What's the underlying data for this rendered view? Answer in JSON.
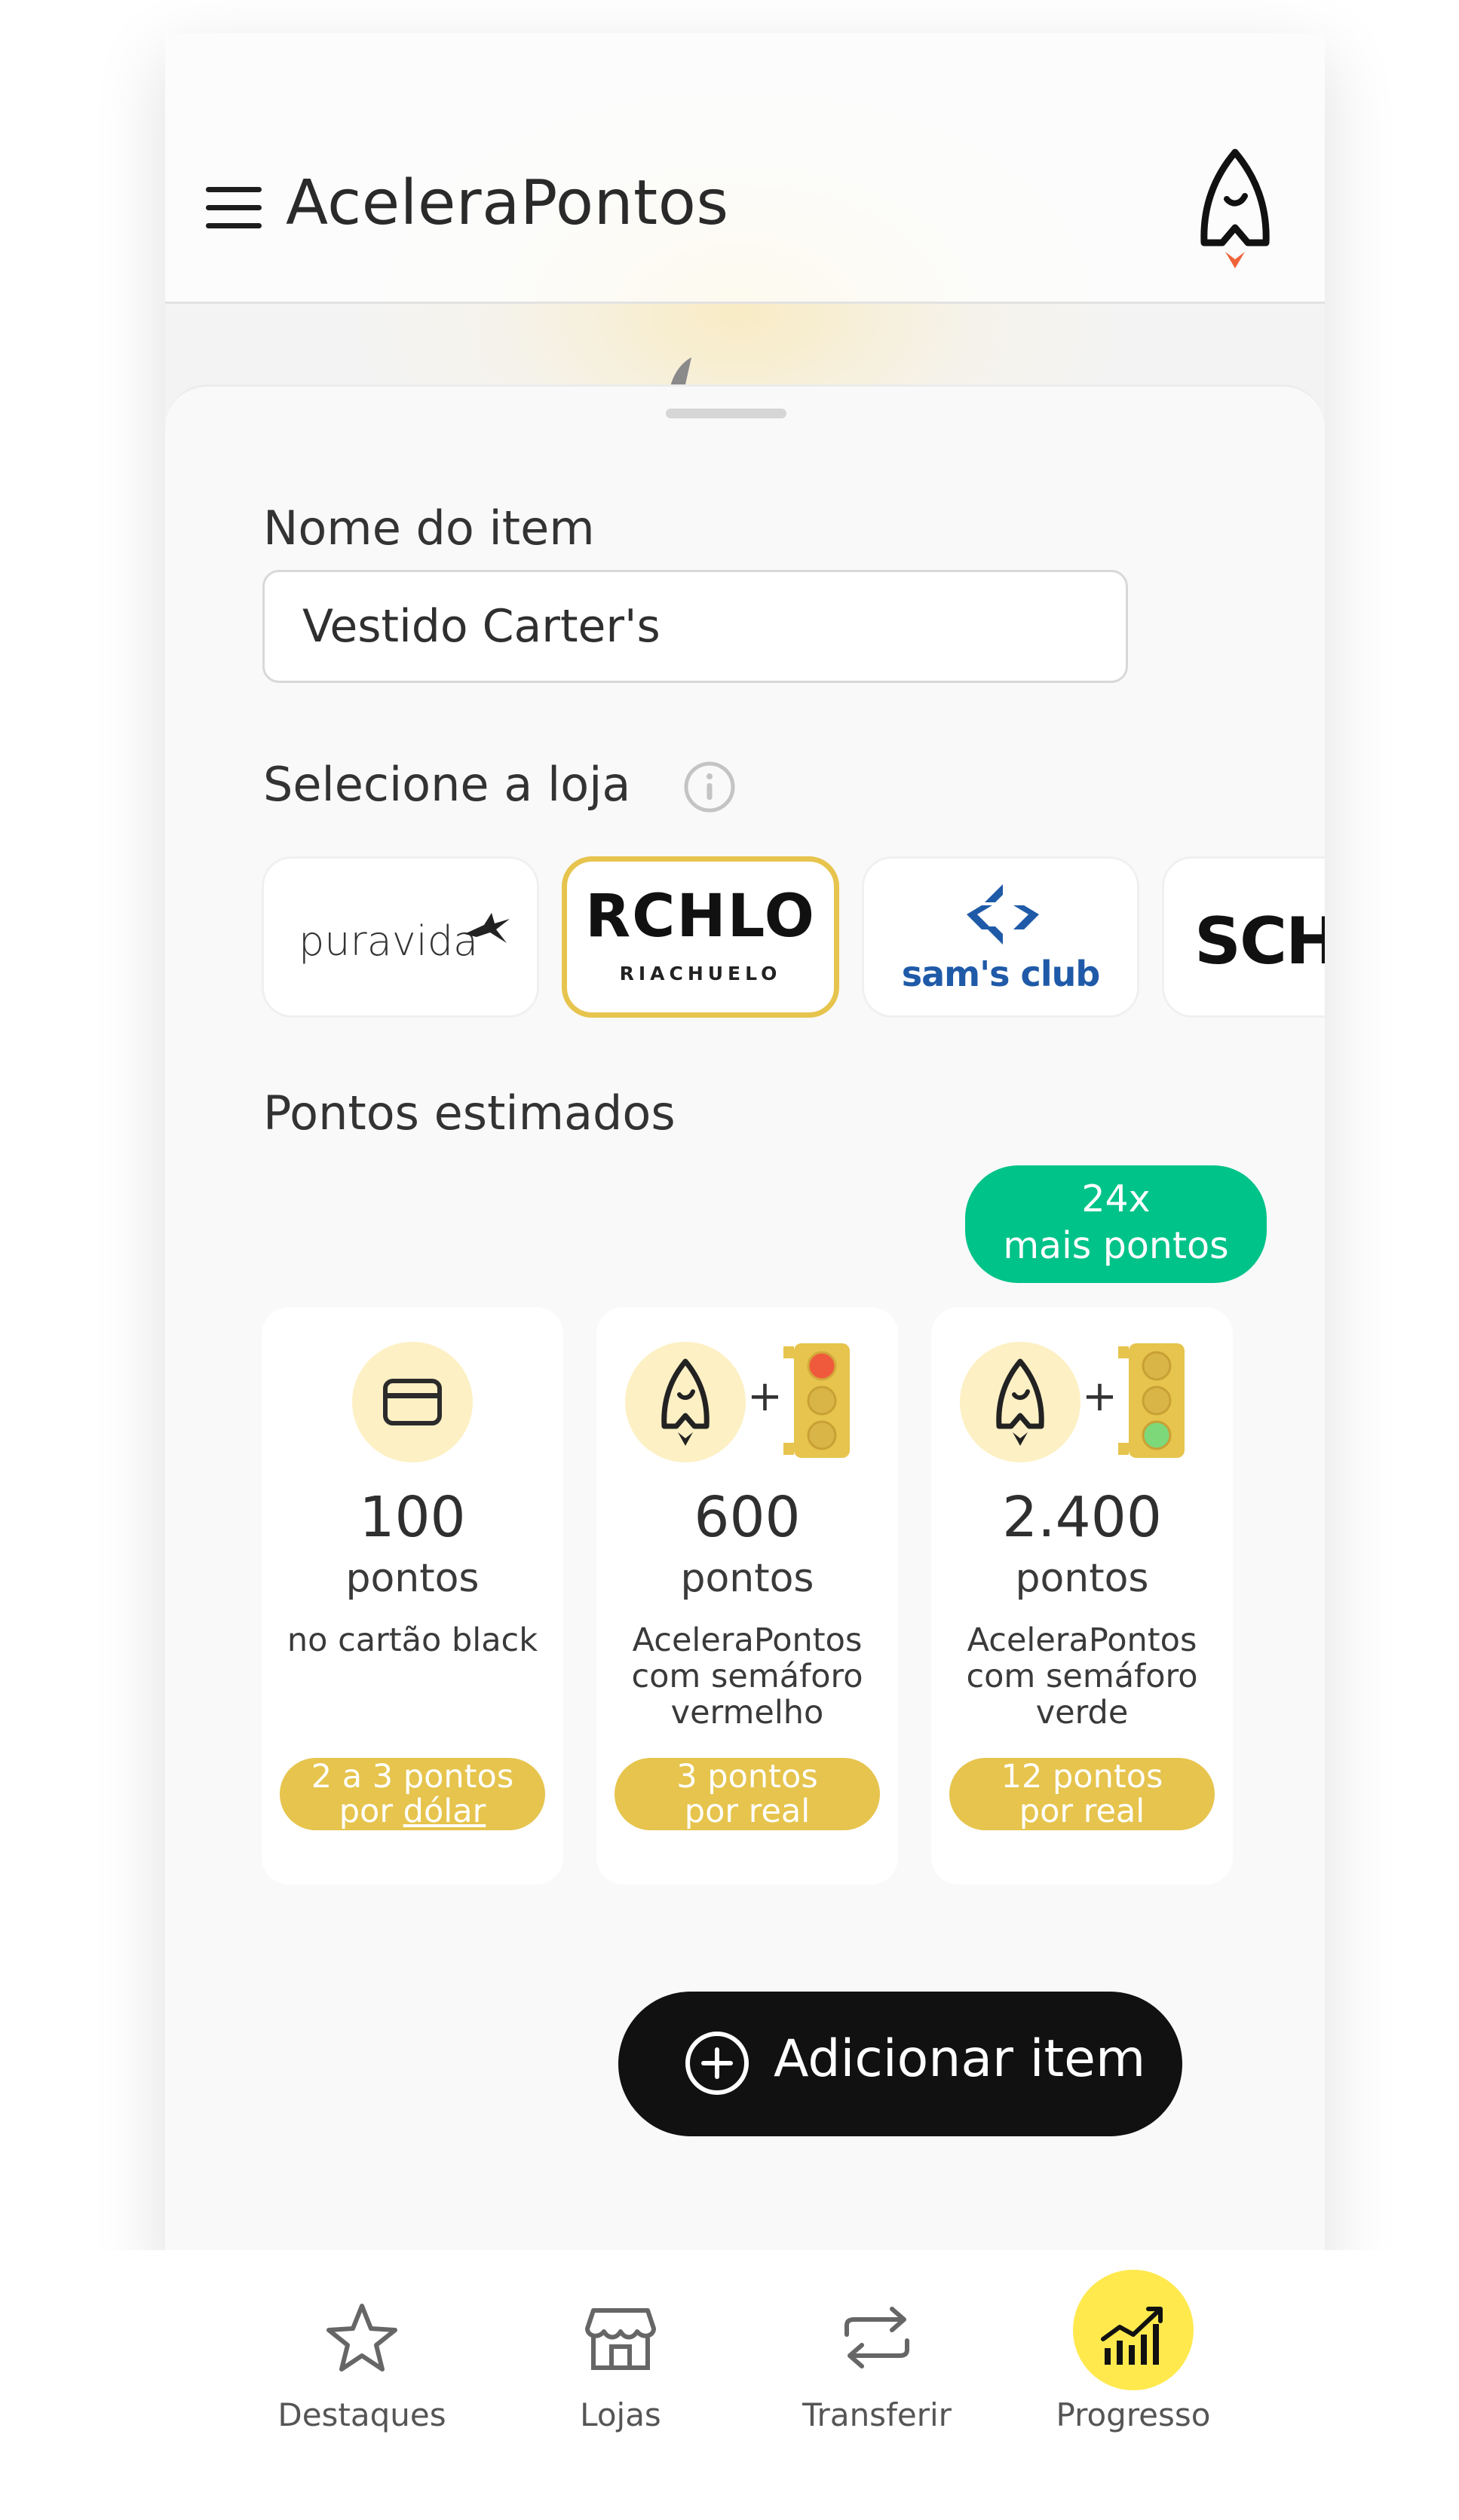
{
  "header": {
    "title": "AceleraPontos"
  },
  "form": {
    "item_name_label": "Nome do item",
    "item_name_value": "Vestido Carter's",
    "store_label": "Selecione a loja",
    "stores": [
      {
        "name": "puravida",
        "selected": false
      },
      {
        "name": "RCHLO",
        "sub": "RIACHUELO",
        "selected": true
      },
      {
        "name": "sam's club",
        "selected": false
      },
      {
        "name": "SCHU",
        "selected": false
      }
    ],
    "estimate_label": "Pontos estimados",
    "badge": {
      "line1": "24x",
      "line2": "mais pontos"
    }
  },
  "cards": [
    {
      "value": "100",
      "unit": "pontos",
      "description": "no cartão black",
      "rate_line1": "2 a 3 pontos",
      "rate_line2_prefix": "por ",
      "rate_line2_link": "dólar"
    },
    {
      "value": "600",
      "unit": "pontos",
      "description": "AceleraPontos com semáforo vermelho",
      "rate_line1": "3 pontos",
      "rate_line2": "por real",
      "plus": "+"
    },
    {
      "value": "2.400",
      "unit": "pontos",
      "description": "AceleraPontos com semáforo verde",
      "rate_line1": "12 pontos",
      "rate_line2": "por real",
      "plus": "+"
    }
  ],
  "actions": {
    "add_item_label": "Adicionar item"
  },
  "nav": [
    {
      "label": "Destaques",
      "icon": "star-icon"
    },
    {
      "label": "Lojas",
      "icon": "store-icon"
    },
    {
      "label": "Transferir",
      "icon": "transfer-icon"
    },
    {
      "label": "Progresso",
      "icon": "chart-icon",
      "active": true
    }
  ],
  "colors": {
    "accent_yellow": "#e6c44d",
    "green_badge": "#00c389",
    "nav_active": "#ffe94d",
    "button_dark": "#111111",
    "traffic_red": "#ef5a3c",
    "traffic_green": "#7dd87a"
  }
}
